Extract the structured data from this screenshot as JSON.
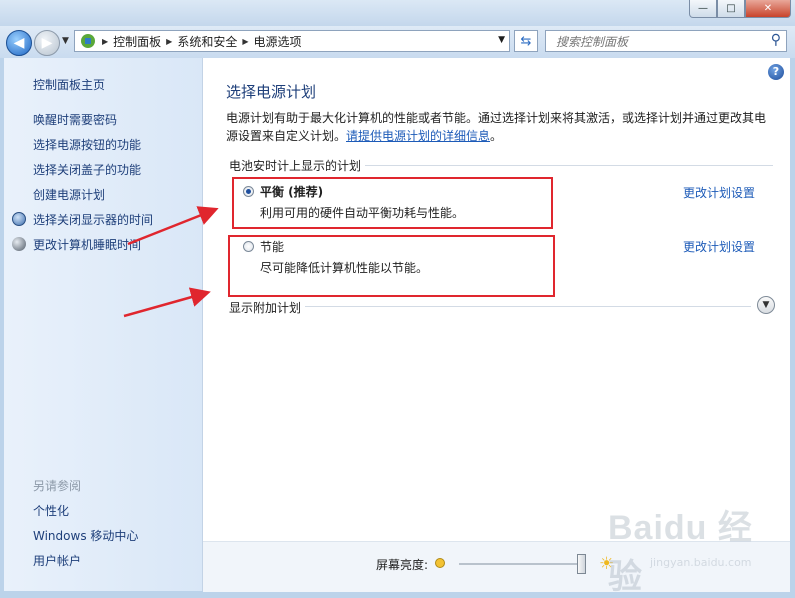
{
  "window": {
    "min_label": "—",
    "max_label": "□",
    "close_label": "✕"
  },
  "nav": {
    "breadcrumb": [
      "控制面板",
      "系统和安全",
      "电源选项"
    ],
    "search_placeholder": "搜索控制面板"
  },
  "sidebar": {
    "items": [
      {
        "label": "控制面板主页",
        "icon": ""
      },
      {
        "label": "唤醒时需要密码",
        "icon": ""
      },
      {
        "label": "选择电源按钮的功能",
        "icon": ""
      },
      {
        "label": "选择关闭盖子的功能",
        "icon": ""
      },
      {
        "label": "创建电源计划",
        "icon": ""
      },
      {
        "label": "选择关闭显示器的时间",
        "icon": "display-clock-icon"
      },
      {
        "label": "更改计算机睡眠时间",
        "icon": "moon-icon"
      }
    ],
    "see_also_heading": "另请参阅",
    "see_also": [
      "个性化",
      "Windows 移动中心",
      "用户帐户"
    ]
  },
  "main": {
    "title": "选择电源计划",
    "intro_text": "电源计划有助于最大化计算机的性能或者节能。通过选择计划来将其激活，或选择计划并通过更改其电源设置来自定义计划。",
    "intro_link": "请提供电源计划的详细信息",
    "intro_end": "。",
    "battery_group": "电池安时计上显示的计划",
    "plans": [
      {
        "name": "平衡 (推荐)",
        "desc": "利用可用的硬件自动平衡功耗与性能。",
        "selected": true,
        "change_label": "更改计划设置"
      },
      {
        "name": "节能",
        "desc": "尽可能降低计算机性能以节能。",
        "selected": false,
        "change_label": "更改计划设置"
      }
    ],
    "extra_group": "显示附加计划"
  },
  "brightness": {
    "label": "屏幕亮度:",
    "level_fraction": 0.98
  },
  "watermark": {
    "brand": "Baidu 经验",
    "url": "jingyan.baidu.com"
  },
  "colors": {
    "accent": "#1e3f7a",
    "link": "#1d5bb8",
    "highlight_box": "#e0262e"
  }
}
